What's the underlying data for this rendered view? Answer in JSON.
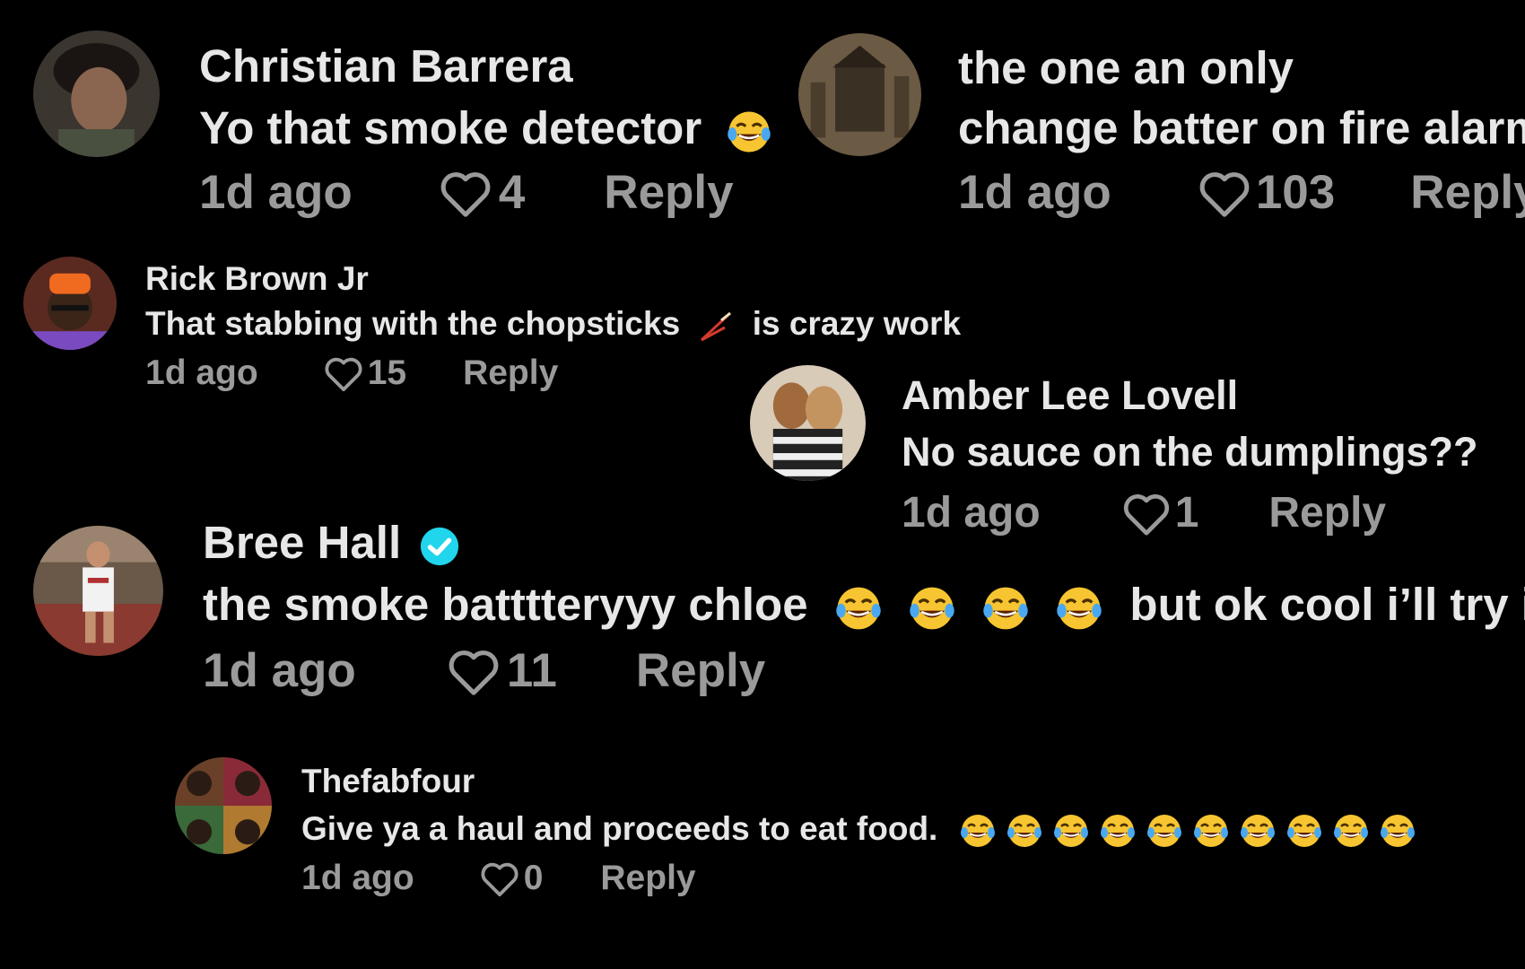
{
  "comments": [
    {
      "author": "Christian Barrera",
      "text": "Yo that smoke detector",
      "emoji_count": 1,
      "time": "1d ago",
      "likes": "4",
      "reply_label": "Reply",
      "avatar_icon": "user-avatar"
    },
    {
      "author": "the one an only",
      "text": "change batter on fire alarm",
      "time": "1d ago",
      "likes": "103",
      "reply_label": "Reply",
      "avatar_icon": "user-avatar"
    },
    {
      "author": "Rick Brown Jr",
      "text_before": "That stabbing with the chopsticks",
      "text_after": "is crazy work",
      "inline_icon": "chopsticks-icon",
      "time": "1d ago",
      "likes": "15",
      "reply_label": "Reply",
      "avatar_icon": "user-avatar"
    },
    {
      "author": "Amber Lee Lovell",
      "text": "No sauce on the dumplings??",
      "time": "1d ago",
      "likes": "1",
      "reply_label": "Reply",
      "avatar_icon": "user-avatar"
    },
    {
      "author": "Bree Hall",
      "verified": true,
      "text_before": "the smoke batttteryyy chloe",
      "text_after": "but ok cool i’ll try it",
      "emoji_count": 4,
      "time": "1d ago",
      "likes": "11",
      "reply_label": "Reply",
      "avatar_icon": "user-avatar"
    },
    {
      "author": "Thefabfour",
      "text": "Give ya a haul and proceeds to eat food.",
      "emoji_count": 10,
      "time": "1d ago",
      "likes": "0",
      "reply_label": "Reply",
      "avatar_icon": "user-avatar"
    }
  ],
  "colors": {
    "background": "#000000",
    "text": "#e7e7e7",
    "meta": "#9a9a9a",
    "verified": "#20d5ec",
    "emoji_face": "#f7c531",
    "emoji_tear": "#4aa8f0"
  }
}
